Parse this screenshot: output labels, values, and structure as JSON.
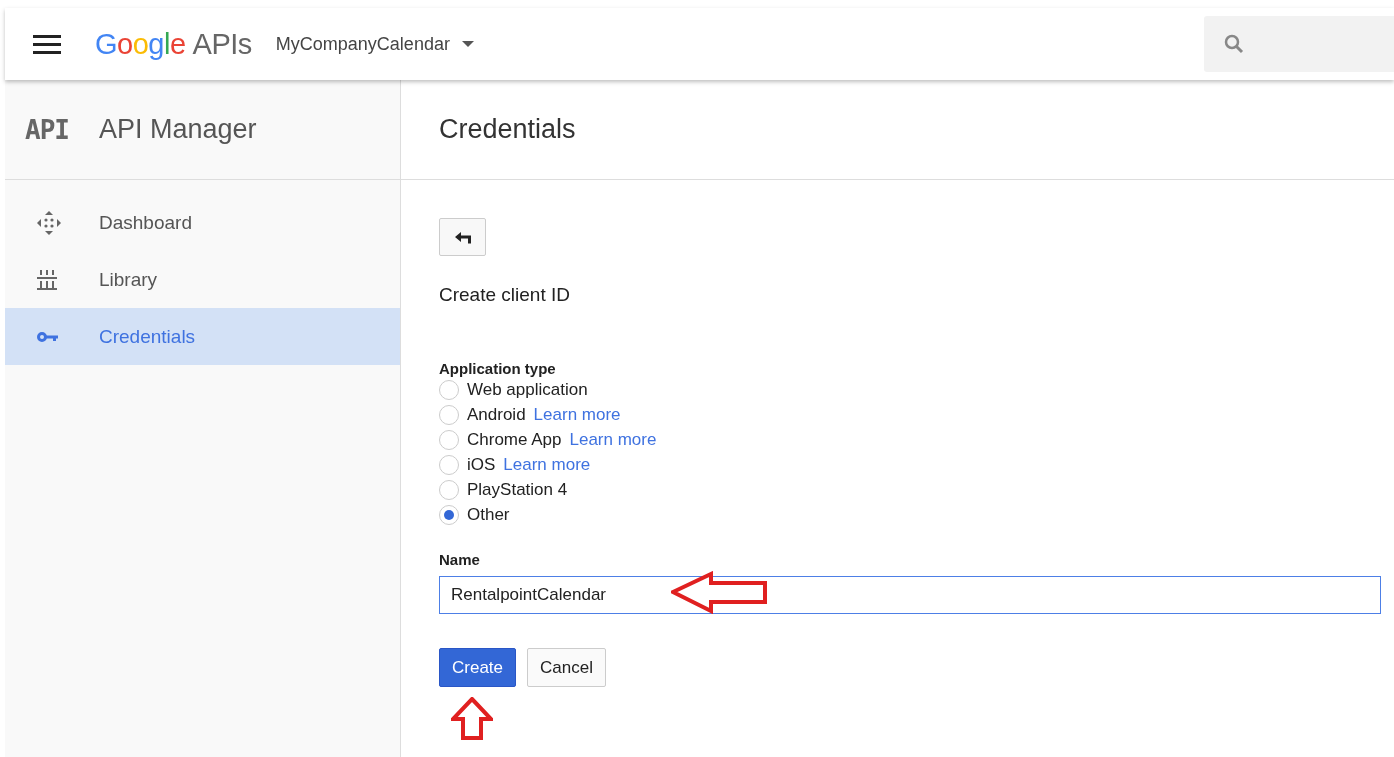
{
  "topbar": {
    "brand": "Google",
    "product": "APIs",
    "project": "MyCompanyCalendar"
  },
  "sidebar": {
    "icon_text": "API",
    "title": "API Manager",
    "items": [
      {
        "label": "Dashboard",
        "selected": false
      },
      {
        "label": "Library",
        "selected": false
      },
      {
        "label": "Credentials",
        "selected": true
      }
    ]
  },
  "page_title": "Credentials",
  "form": {
    "heading": "Create client ID",
    "application_type": {
      "label": "Application type",
      "options": [
        {
          "label": "Web application",
          "selected": false
        },
        {
          "label": "Android",
          "link": "Learn more",
          "selected": false
        },
        {
          "label": "Chrome App",
          "link": "Learn more",
          "selected": false
        },
        {
          "label": "iOS",
          "link": "Learn more",
          "selected": false
        },
        {
          "label": "PlayStation 4",
          "selected": false
        },
        {
          "label": "Other",
          "selected": true
        }
      ]
    },
    "name": {
      "label": "Name",
      "value": "RentalpointCalendar"
    },
    "buttons": [
      {
        "label": "Create",
        "kind": "primary"
      },
      {
        "label": "Cancel",
        "kind": "default"
      }
    ]
  }
}
